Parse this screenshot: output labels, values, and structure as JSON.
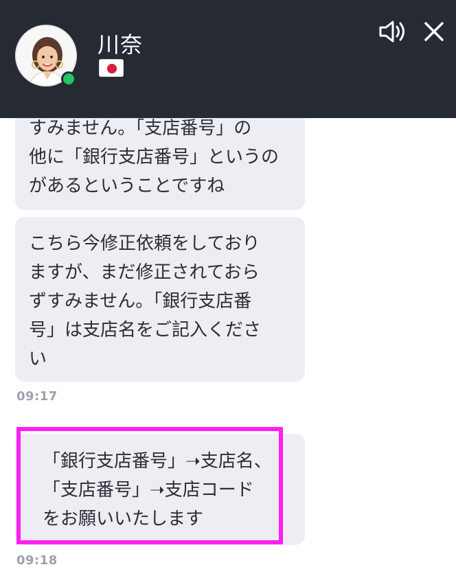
{
  "header": {
    "contact_name": "川奈",
    "flag_icon": "japan-flag-icon",
    "online_status_color": "#22c55e",
    "sound_icon": "speaker-icon",
    "close_icon": "close-icon"
  },
  "messages": [
    {
      "text": "すみません。「支店番号」の\n他に「銀行支店番号」というの\nがあるということですね"
    },
    {
      "text": "こちら今修正依頼をしており\nますが、まだ修正されておら\nずすみません。「銀行支店番\n号」は支店名をご記入くださ\nい",
      "time": "09:17"
    },
    {
      "text": "「銀行支店番号」➝支店名、\n「支店番号」➝支店コード\nをお願いいたします",
      "time": "09:18"
    }
  ],
  "highlight_color": "#ff1ff0"
}
